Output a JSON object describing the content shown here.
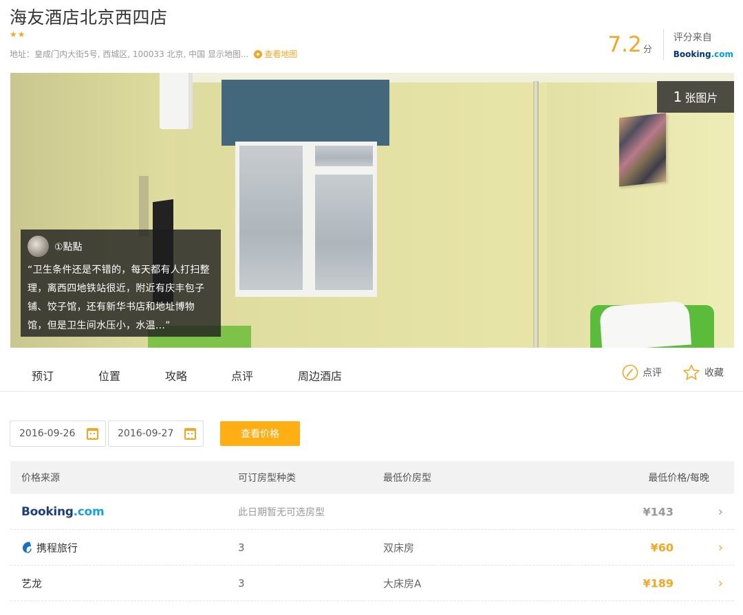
{
  "hotel": {
    "name": "海友酒店北京西四店",
    "stars": 2,
    "address": "地址：皇成门内大街5号, 西城区, 100033 北京, 中国 显示地图...",
    "map_link": "查看地图"
  },
  "rating": {
    "score": "7.2",
    "unit": "分",
    "source_label": "评分来自",
    "source_name": "Booking",
    "source_tld": ".com"
  },
  "gallery": {
    "photo_count": "1",
    "photo_label": "张图片",
    "review": {
      "user": "①點點",
      "text": "“卫生条件还是不错的，每天都有人打扫整理，离西四地铁站很近，附近有庆丰包子铺、饺子馆，还有新华书店和地址博物馆，但是卫生间水压小，水温...”"
    }
  },
  "tabs": [
    "预订",
    "位置",
    "攻略",
    "点评",
    "周边酒店"
  ],
  "actions": {
    "review": "点评",
    "favorite": "收藏"
  },
  "search": {
    "checkin": "2016-09-26",
    "checkout": "2016-09-27",
    "button": "查看价格"
  },
  "table": {
    "headers": [
      "价格来源",
      "可订房型种类",
      "最低价房型",
      "最低价格/每晚"
    ],
    "rows": [
      {
        "source": "Booking",
        "source_tld": ".com",
        "count": "",
        "note": "此日期暂无可选房型",
        "room": "",
        "price": "¥143"
      },
      {
        "source": "携程旅行",
        "count": "3",
        "room": "双床房",
        "price": "¥60"
      },
      {
        "source": "艺龙",
        "count": "3",
        "room": "大床房A",
        "price": "¥189"
      }
    ]
  },
  "colors": {
    "accent": "#f5a623",
    "button": "#ffae14",
    "booking_blue": "#1f3d7a"
  }
}
